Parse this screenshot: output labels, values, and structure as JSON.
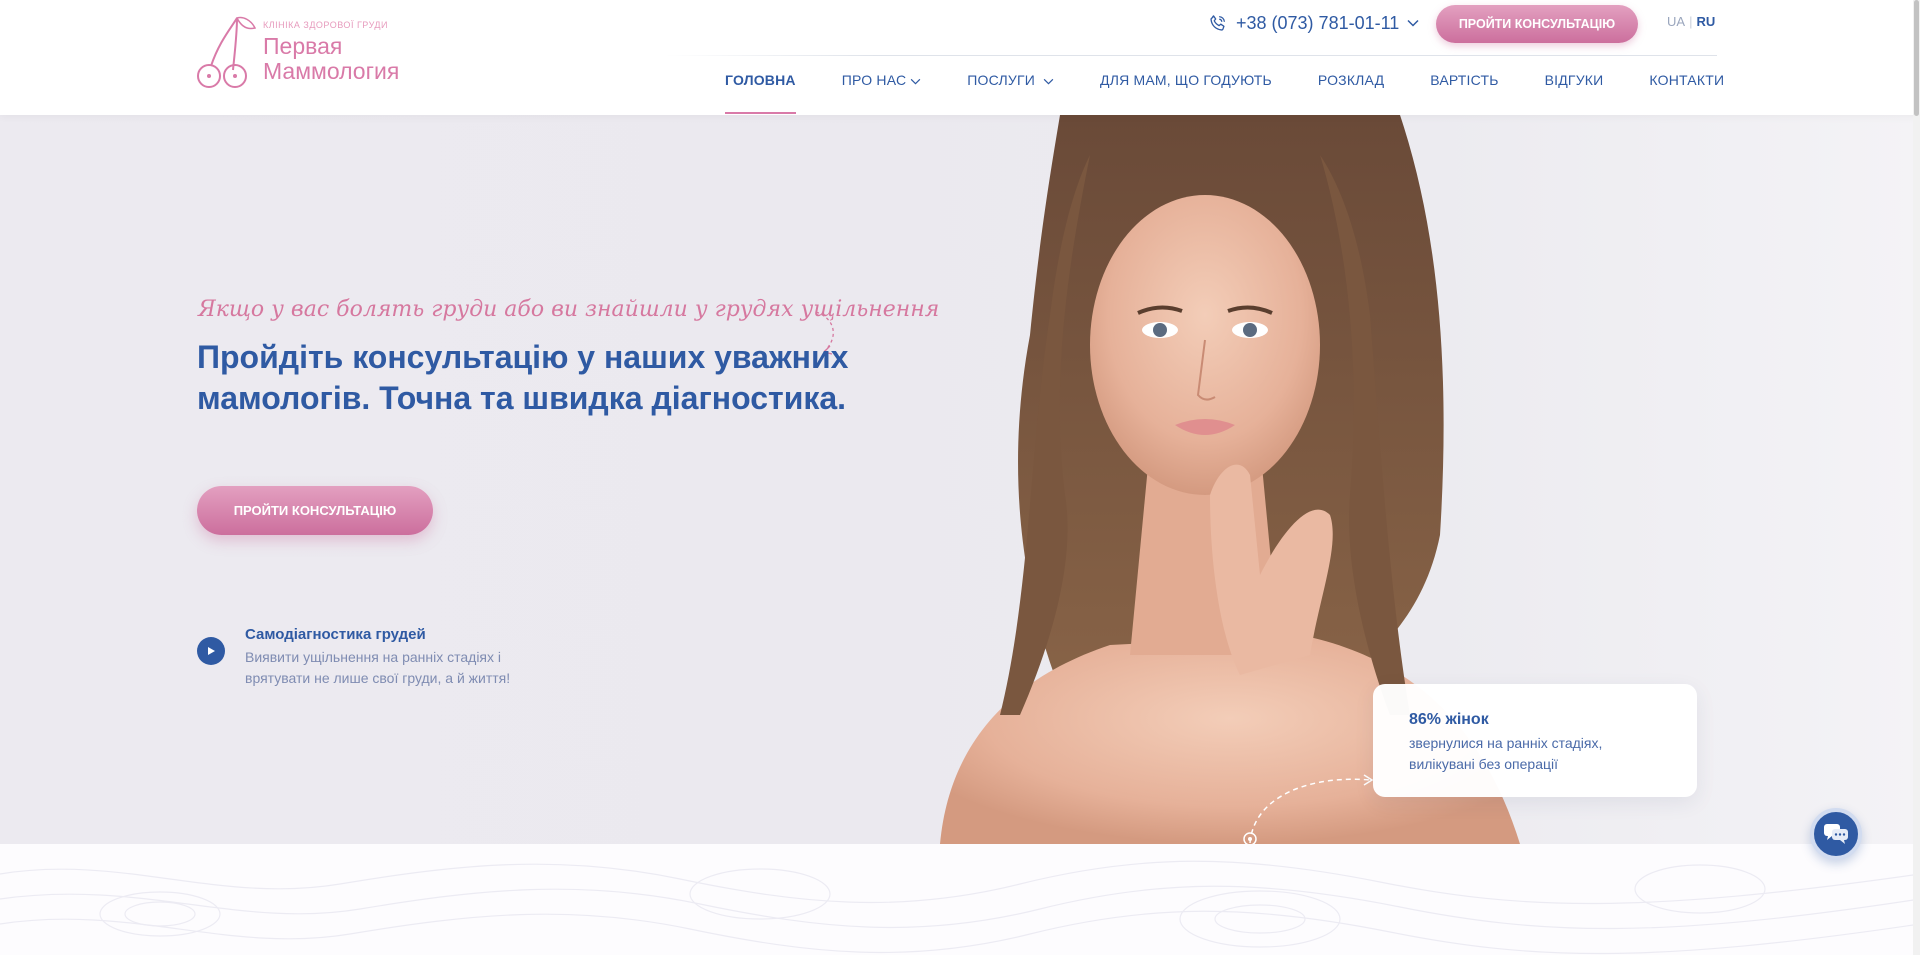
{
  "header": {
    "logo": {
      "subtitle": "Клініка здорової груди",
      "title_line1": "Первая",
      "title_line2": "Маммология"
    },
    "phone": "+38 (073) 781-01-11",
    "cta_label": "ПРОЙТИ КОНСУЛЬТАЦІЮ",
    "lang": {
      "ua": "UA",
      "ru": "RU",
      "active": "RU"
    }
  },
  "nav": [
    {
      "label": "ГОЛОВНА",
      "active": true
    },
    {
      "label": "ПРО НАС",
      "dropdown": true
    },
    {
      "label": "ПОСЛУГИ",
      "dropdown": true
    },
    {
      "label": "ДЛЯ МАМ, ЩО ГОДУЮТЬ"
    },
    {
      "label": "РОЗКЛАД"
    },
    {
      "label": "ВАРТІСТЬ"
    },
    {
      "label": "ВІДГУКИ"
    },
    {
      "label": "КОНТАКТИ"
    }
  ],
  "hero": {
    "script_text": "Якщо у вас болять груди або ви знайшли у грудях ущільнення",
    "title": "Пройдіть консультацію у наших уважних мамологів. Точна та швидка діагностика.",
    "cta_label": "ПРОЙТИ КОНСУЛЬТАЦІЮ",
    "selfdiag": {
      "title": "Самодіагностика грудей",
      "description": "Виявити ущільнення на ранніх стадіях і врятувати не лише свої груди, а й життя!"
    },
    "stat": {
      "title": "86% жінок",
      "description": "звернулися на ранніх стадіях, вилікувані без операції"
    }
  },
  "colors": {
    "primary": "#2f5aa3",
    "accent": "#d97aa8",
    "hero_bg": "#ebe9ef"
  },
  "icons": [
    "cherry-logo-icon",
    "phone-icon",
    "chevron-down-icon",
    "play-icon",
    "chat-icon"
  ]
}
